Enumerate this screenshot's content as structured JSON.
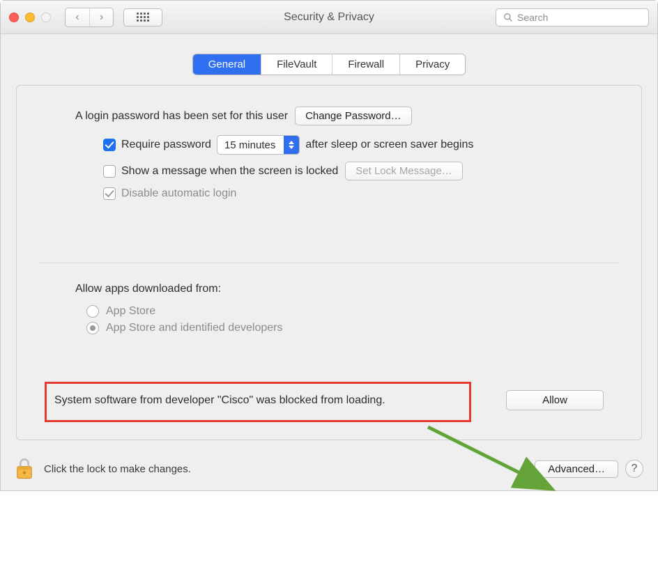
{
  "window": {
    "title": "Security & Privacy",
    "search_placeholder": "Search"
  },
  "tabs": {
    "general": "General",
    "filevault": "FileVault",
    "firewall": "Firewall",
    "privacy": "Privacy"
  },
  "general": {
    "login_password_text": "A login password has been set for this user",
    "change_password_label": "Change Password…",
    "require_password_label": "Require password",
    "require_password_delay": "15 minutes",
    "require_password_suffix": "after sleep or screen saver begins",
    "show_message_label": "Show a message when the screen is locked",
    "set_lock_message_label": "Set Lock Message…",
    "disable_auto_login_label": "Disable automatic login",
    "allow_apps_title": "Allow apps downloaded from:",
    "radio_app_store": "App Store",
    "radio_identified": "App Store and identified developers",
    "blocked_message": "System software from developer \"Cisco\" was blocked from loading.",
    "allow_button": "Allow"
  },
  "footer": {
    "lock_text": "Click the lock to make changes.",
    "advanced_label": "Advanced…"
  },
  "colors": {
    "accent": "#2f6ff0",
    "highlight_box": "#e53a2f",
    "arrow": "#63a338"
  }
}
